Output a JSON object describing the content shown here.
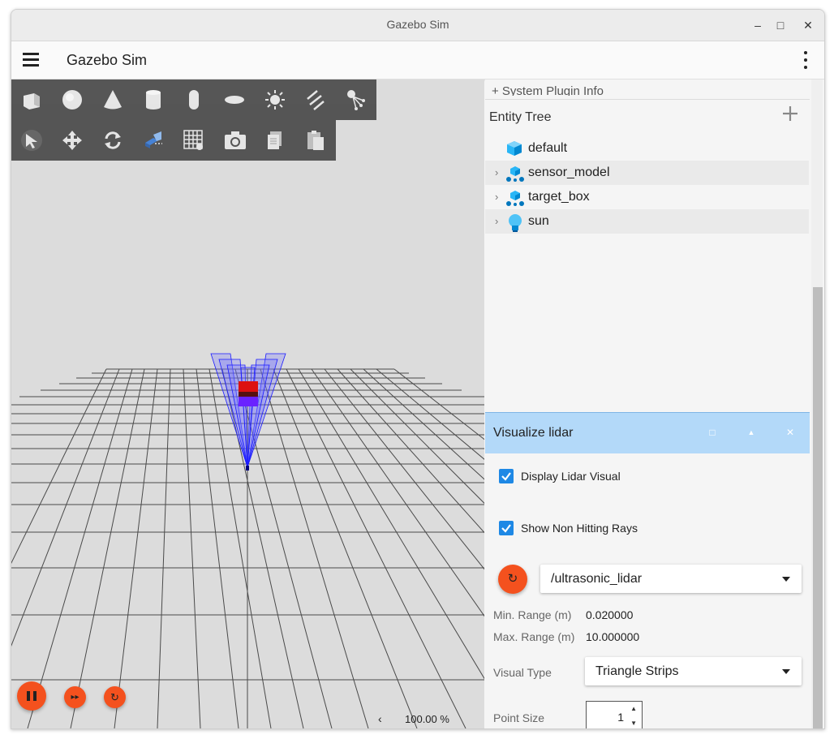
{
  "window": {
    "title": "Gazebo Sim",
    "controls": [
      "minimize",
      "maximize",
      "close"
    ],
    "minimize_glyph": "–",
    "maximize_glyph": "□",
    "close_glyph": "✕"
  },
  "appbar": {
    "title": "Gazebo Sim"
  },
  "shapes_toolbar": [
    "box-icon",
    "sphere-icon",
    "cone-icon",
    "cylinder-icon",
    "capsule-icon",
    "ellipsoid-icon",
    "point-light-icon",
    "directional-light-icon",
    "spot-light-icon"
  ],
  "transform_toolbar": [
    "select-arrow-icon",
    "translate-icon",
    "rotate-icon",
    "snap-icon",
    "grid-icon",
    "screenshot-icon",
    "copy-icon",
    "paste-icon"
  ],
  "sim_controls": {
    "play_pause": "pause-icon",
    "step": "step-forward-icon",
    "reset": "reset-icon",
    "step_glyph": "▸▸",
    "reset_glyph": "↻"
  },
  "zoom": {
    "arrow": "‹",
    "value": "100.00 %"
  },
  "right_panel": {
    "plugin_info_label": "+ System Plugin Info",
    "entity_tree": {
      "title": "Entity Tree",
      "items": [
        {
          "label": "default",
          "icon": "world-cube-icon",
          "expandable": false
        },
        {
          "label": "sensor_model",
          "icon": "model-icon",
          "expandable": true
        },
        {
          "label": "target_box",
          "icon": "model-icon",
          "expandable": true
        },
        {
          "label": "sun",
          "icon": "light-bulb-icon",
          "expandable": true
        }
      ],
      "expand_glyph": "›"
    },
    "visualize_lidar": {
      "title": "Visualize lidar",
      "header_glyphs": {
        "float": "□",
        "collapse": "▲",
        "close": "✕"
      },
      "display_lidar_visual": {
        "label": "Display Lidar Visual",
        "checked": true
      },
      "show_non_hitting_rays": {
        "label": "Show Non Hitting Rays",
        "checked": true
      },
      "refresh_glyph": "↻",
      "topic": "/ultrasonic_lidar",
      "min_range": {
        "label": "Min. Range (m)",
        "value": "0.020000"
      },
      "max_range": {
        "label": "Max. Range (m)",
        "value": "10.000000"
      },
      "visual_type": {
        "label": "Visual Type",
        "value": "Triangle Strips"
      },
      "point_size": {
        "label": "Point Size",
        "value": "1",
        "up_glyph": "▲",
        "down_glyph": "▼"
      }
    }
  },
  "colors": {
    "accent_orange": "#f4511e",
    "checkbox_blue": "#1e88e5",
    "panel_header_blue": "#b3d9f9",
    "viewport_bg": "#dcdcdc",
    "lidar_blue": "#1a1aff",
    "box_red": "#dd1111"
  }
}
